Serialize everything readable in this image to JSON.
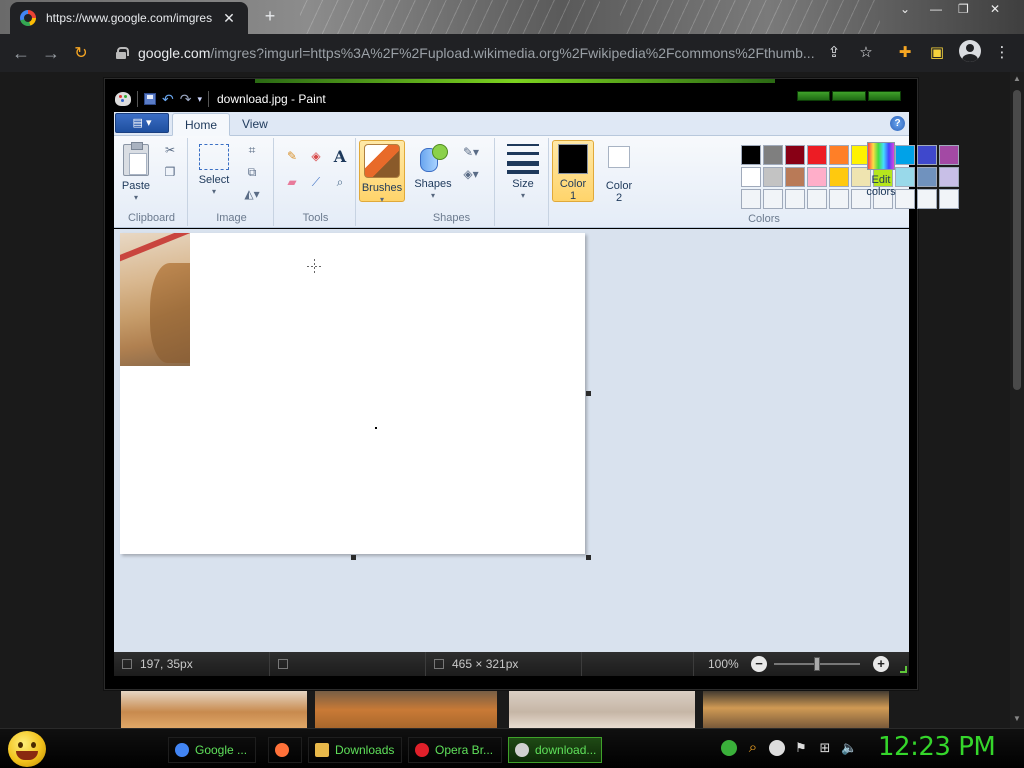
{
  "browser": {
    "tab_title": "https://www.google.com/imgres",
    "tab_close": "✕",
    "new_tab": "+",
    "url_host": "google.com",
    "url_path": "/imgres?imgurl=https%3A%2F%2Fupload.wikimedia.org%2Fwikipedia%2Fcommons%2Fthumb...",
    "window_controls": {
      "minimize": "⌄",
      "restore": "—",
      "maximize": "❐",
      "close": "✕"
    }
  },
  "paint": {
    "title": "download.jpg - Paint",
    "tabs": [
      "Home",
      "View"
    ],
    "groups": {
      "clipboard": {
        "label": "Clipboard",
        "paste": "Paste"
      },
      "image": {
        "label": "Image",
        "select": "Select"
      },
      "tools": {
        "label": "Tools"
      },
      "brushes": {
        "label": "Brushes"
      },
      "shapes": {
        "label": "Shapes",
        "shapes": "Shapes"
      },
      "size": {
        "label": "Size"
      },
      "colors": {
        "label": "Colors",
        "color1": "Color 1",
        "color2": "Color 2",
        "edit": "Edit colors"
      }
    },
    "color1": "#000000",
    "color2": "#ffffff",
    "palette": [
      "#000000",
      "#7f7f7f",
      "#880015",
      "#ed1c24",
      "#ff7f27",
      "#fff200",
      "#22b14c",
      "#00a2e8",
      "#3f48cc",
      "#a349a4",
      "#ffffff",
      "#c3c3c3",
      "#b97a57",
      "#ffaec9",
      "#ffc90e",
      "#efe4b0",
      "#b5e61d",
      "#99d9ea",
      "#7092be",
      "#c8bfe7",
      "#f1f4f8",
      "#f1f4f8",
      "#f1f4f8",
      "#f1f4f8",
      "#f1f4f8",
      "#f1f4f8",
      "#f1f4f8",
      "#f1f4f8",
      "#f1f4f8",
      "#f1f4f8"
    ],
    "status": {
      "cursor_pos": "197, 35px",
      "canvas_size": "465 × 321px",
      "zoom": "100%"
    }
  },
  "taskbar": {
    "items": [
      {
        "label": "Google ...",
        "icon": "chrome-icon",
        "color": "#4285f4"
      },
      {
        "label": "",
        "icon": "firefox-icon",
        "color": "#ff7139"
      },
      {
        "label": "Downloads",
        "icon": "folder-icon",
        "color": "#e8b84a"
      },
      {
        "label": "Opera Br...",
        "icon": "opera-icon",
        "color": "#e0202a"
      },
      {
        "label": "download...",
        "icon": "paint-icon",
        "color": "#d0d0d0"
      }
    ],
    "clock": "12:23 PM"
  }
}
